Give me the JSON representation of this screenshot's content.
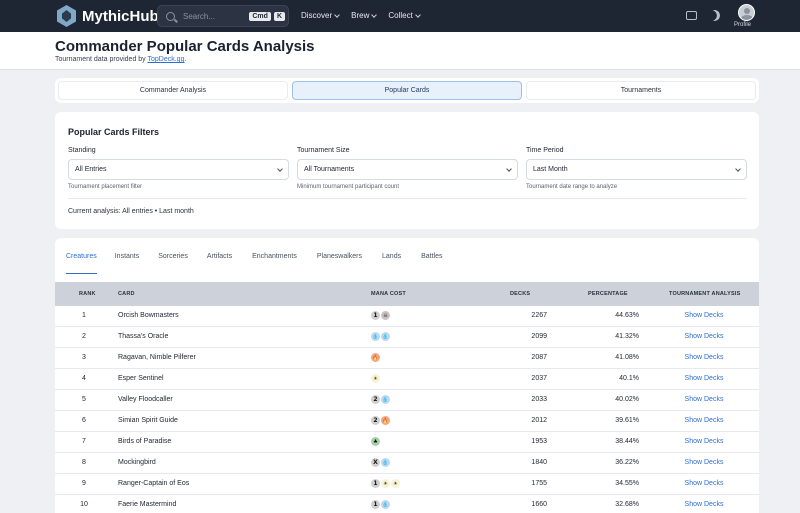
{
  "nav": {
    "logo_text": "MythicHub",
    "search_placeholder": "Search...",
    "kbd_cmd": "Cmd",
    "kbd_k": "K",
    "links": [
      "Discover",
      "Brew",
      "Collect"
    ],
    "profile_label": "Profile"
  },
  "header": {
    "title": "Commander Popular Cards Analysis",
    "subtitle_prefix": "Tournament data provided by ",
    "subtitle_link": "TopDeck.gg",
    "subtitle_suffix": "."
  },
  "view_tabs": [
    "Commander Analysis",
    "Popular Cards",
    "Tournaments"
  ],
  "view_tab_active": 1,
  "filters": {
    "title": "Popular Cards Filters",
    "standing": {
      "label": "Standing",
      "value": "All Entries",
      "help": "Tournament placement filter"
    },
    "size": {
      "label": "Tournament Size",
      "value": "All Tournaments",
      "help": "Minimum tournament participant count"
    },
    "period": {
      "label": "Time Period",
      "value": "Last Month",
      "help": "Tournament date range to analyze"
    },
    "current": "Current analysis: All entries • Last month"
  },
  "category_tabs": [
    "Creatures",
    "Instants",
    "Sorceries",
    "Artifacts",
    "Enchantments",
    "Planeswalkers",
    "Lands",
    "Battles"
  ],
  "category_active": 0,
  "table": {
    "headers": {
      "rank": "RANK",
      "card": "CARD",
      "mana": "MANA COST",
      "decks": "DECKS",
      "pct": "PERCENTAGE",
      "analysis": "TOURNAMENT ANALYSIS"
    },
    "link_label": "Show Decks",
    "rows": [
      {
        "rank": "1",
        "card": "Orcish Bowmasters",
        "decks": "2267",
        "pct": "44.63%",
        "mana": [
          "1",
          "B"
        ]
      },
      {
        "rank": "2",
        "card": "Thassa's Oracle",
        "decks": "2099",
        "pct": "41.32%",
        "mana": [
          "U",
          "U"
        ]
      },
      {
        "rank": "3",
        "card": "Ragavan, Nimble Pilferer",
        "decks": "2087",
        "pct": "41.08%",
        "mana": [
          "R"
        ]
      },
      {
        "rank": "4",
        "card": "Esper Sentinel",
        "decks": "2037",
        "pct": "40.1%",
        "mana": [
          "W"
        ]
      },
      {
        "rank": "5",
        "card": "Valley Floodcaller",
        "decks": "2033",
        "pct": "40.02%",
        "mana": [
          "2",
          "U"
        ]
      },
      {
        "rank": "6",
        "card": "Simian Spirit Guide",
        "decks": "2012",
        "pct": "39.61%",
        "mana": [
          "2",
          "R"
        ]
      },
      {
        "rank": "7",
        "card": "Birds of Paradise",
        "decks": "1953",
        "pct": "38.44%",
        "mana": [
          "G"
        ]
      },
      {
        "rank": "8",
        "card": "Mockingbird",
        "decks": "1840",
        "pct": "36.22%",
        "mana": [
          "X",
          "U"
        ]
      },
      {
        "rank": "9",
        "card": "Ranger-Captain of Eos",
        "decks": "1755",
        "pct": "34.55%",
        "mana": [
          "1",
          "W",
          "W"
        ]
      },
      {
        "rank": "10",
        "card": "Faerie Mastermind",
        "decks": "1660",
        "pct": "32.68%",
        "mana": [
          "1",
          "U"
        ]
      }
    ]
  },
  "mana_colors": {
    "W": "#f8f3d2",
    "U": "#bcd8ef",
    "B": "#cbc2bf",
    "R": "#f0a88a",
    "G": "#a7d0a9",
    "generic": "#cfcfcf"
  },
  "mana_glyphs": {
    "W": "☀",
    "U": "💧",
    "B": "☠",
    "R": "🔥",
    "G": "♣"
  },
  "accent": "#2d6fcf"
}
